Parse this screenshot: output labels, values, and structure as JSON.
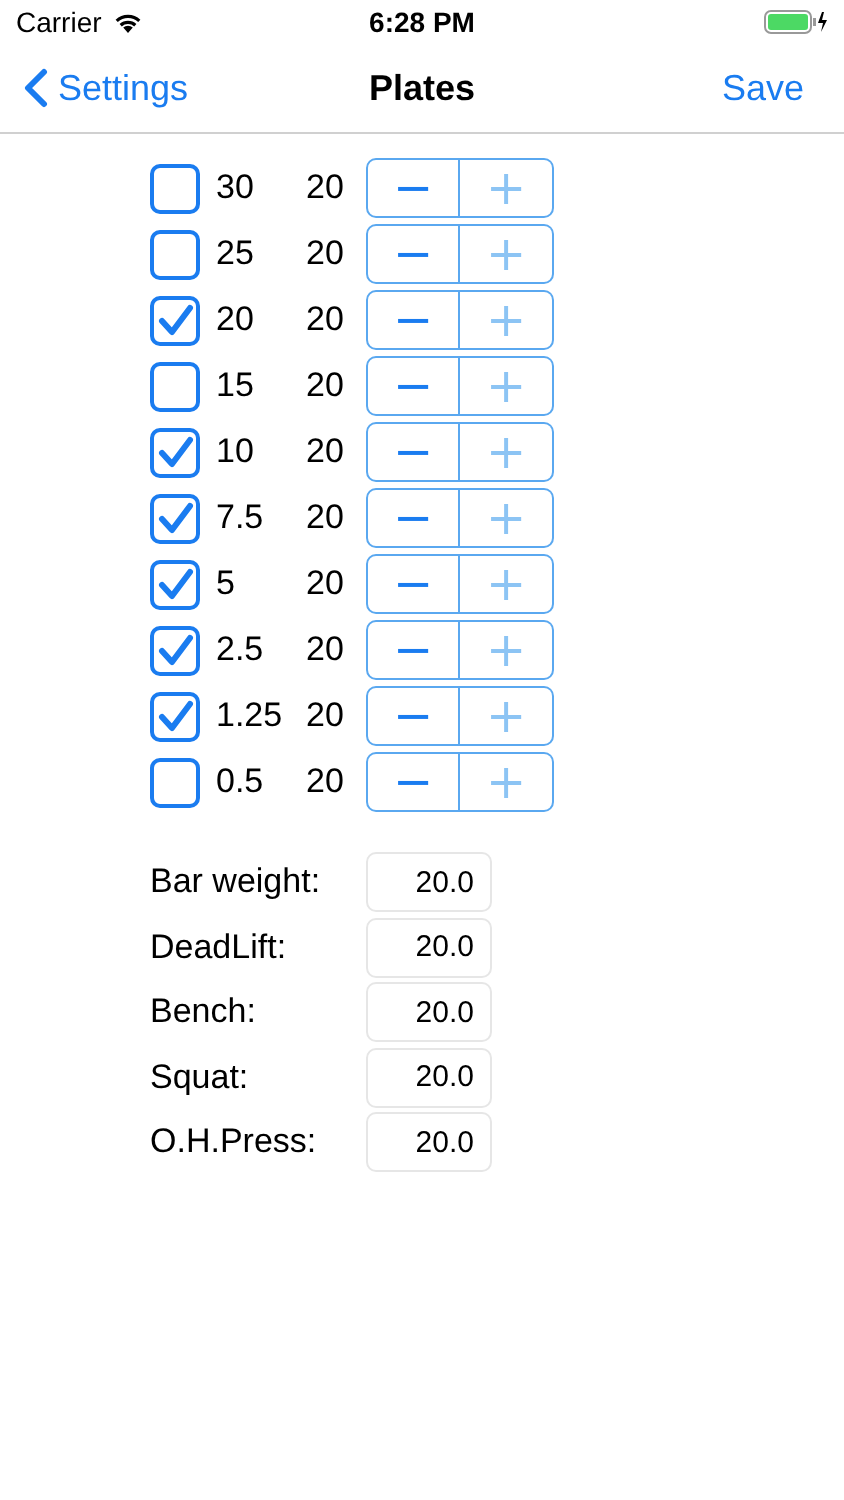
{
  "status_bar": {
    "carrier": "Carrier",
    "time": "6:28 PM"
  },
  "nav": {
    "back": "Settings",
    "title": "Plates",
    "action": "Save"
  },
  "plates": [
    {
      "weight": "30",
      "count": "20",
      "checked": false,
      "minus": "−",
      "plus": "+",
      "plus_disabled": true
    },
    {
      "weight": "25",
      "count": "20",
      "checked": false,
      "minus": "−",
      "plus": "+",
      "plus_disabled": true
    },
    {
      "weight": "20",
      "count": "20",
      "checked": true,
      "minus": "−",
      "plus": "+",
      "plus_disabled": true
    },
    {
      "weight": "15",
      "count": "20",
      "checked": false,
      "minus": "−",
      "plus": "+",
      "plus_disabled": true
    },
    {
      "weight": "10",
      "count": "20",
      "checked": true,
      "minus": "−",
      "plus": "+",
      "plus_disabled": true
    },
    {
      "weight": "7.5",
      "count": "20",
      "checked": true,
      "minus": "−",
      "plus": "+",
      "plus_disabled": true
    },
    {
      "weight": "5",
      "count": "20",
      "checked": true,
      "minus": "−",
      "plus": "+",
      "plus_disabled": true
    },
    {
      "weight": "2.5",
      "count": "20",
      "checked": true,
      "minus": "−",
      "plus": "+",
      "plus_disabled": true
    },
    {
      "weight": "1.25",
      "count": "20",
      "checked": true,
      "minus": "−",
      "plus": "+",
      "plus_disabled": true
    },
    {
      "weight": "0.5",
      "count": "20",
      "checked": false,
      "minus": "−",
      "plus": "+",
      "plus_disabled": true
    }
  ],
  "fields": [
    {
      "label": "Bar weight:",
      "value": "20.0"
    },
    {
      "label": "DeadLift:",
      "value": "20.0"
    },
    {
      "label": "Bench:",
      "value": "20.0"
    },
    {
      "label": "Squat:",
      "value": "20.0"
    },
    {
      "label": "O.H.Press:",
      "value": "20.0"
    }
  ]
}
